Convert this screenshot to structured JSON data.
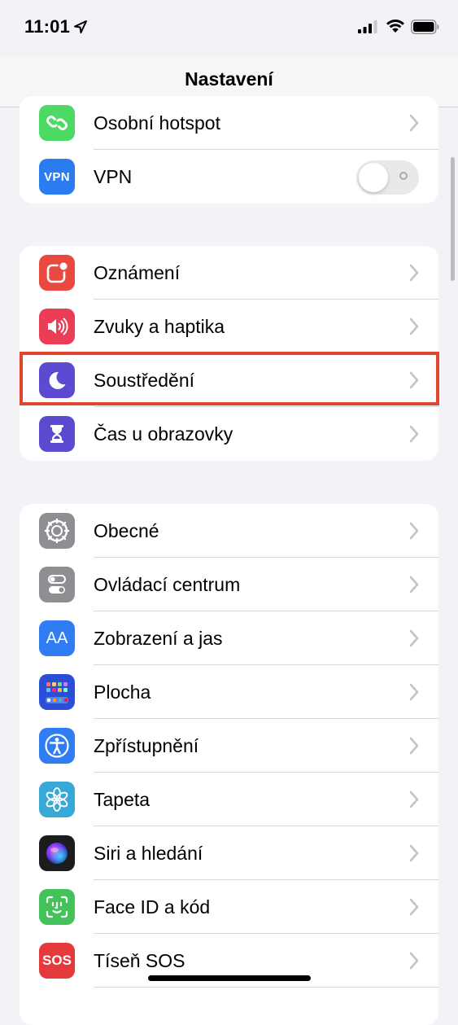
{
  "status_bar": {
    "time": "11:01"
  },
  "nav": {
    "title": "Nastavení"
  },
  "colors": {
    "highlight": "#e0452e",
    "hotspot": "#4cd964",
    "vpn": "#2b7cf0",
    "notifications": "#e9493f",
    "sounds": "#eb3d55",
    "focus": "#5a4bd1",
    "screen_time": "#5a4bd1",
    "general": "#8e8e93",
    "control_center": "#8e8e93",
    "display": "#2f7cf3",
    "home_screen": "#2a4fd6",
    "accessibility": "#2f7cf3",
    "wallpaper": "#38a8d6",
    "siri": "#1c1c1e",
    "face_id": "#44c25a",
    "sos": "#e5393b"
  },
  "groups": [
    {
      "rows": [
        {
          "label": "Osobní hotspot",
          "icon": "hotspot-chain-icon",
          "accessory": "chevron"
        },
        {
          "label": "VPN",
          "icon": "vpn-icon",
          "icon_text": "VPN",
          "accessory": "toggle",
          "toggle_on": false
        }
      ]
    },
    {
      "rows": [
        {
          "label": "Oznámení",
          "icon": "notifications-icon",
          "accessory": "chevron"
        },
        {
          "label": "Zvuky a haptika",
          "icon": "speaker-icon",
          "accessory": "chevron"
        },
        {
          "label": "Soustředění",
          "icon": "moon-icon",
          "accessory": "chevron",
          "highlighted": true
        },
        {
          "label": "Čas u obrazovky",
          "icon": "hourglass-icon",
          "accessory": "chevron"
        }
      ]
    },
    {
      "rows": [
        {
          "label": "Obecné",
          "icon": "gear-icon",
          "accessory": "chevron"
        },
        {
          "label": "Ovládací centrum",
          "icon": "switches-icon",
          "accessory": "chevron"
        },
        {
          "label": "Zobrazení a jas",
          "icon": "text-size-icon",
          "icon_text": "AA",
          "accessory": "chevron"
        },
        {
          "label": "Plocha",
          "icon": "home-screen-grid-icon",
          "accessory": "chevron"
        },
        {
          "label": "Zpřístupnění",
          "icon": "accessibility-person-icon",
          "accessory": "chevron"
        },
        {
          "label": "Tapeta",
          "icon": "flower-icon",
          "accessory": "chevron"
        },
        {
          "label": "Siri a hledání",
          "icon": "siri-orb-icon",
          "accessory": "chevron"
        },
        {
          "label": "Face ID a kód",
          "icon": "face-id-icon",
          "accessory": "chevron"
        },
        {
          "label": "Tíseň SOS",
          "icon": "sos-icon",
          "icon_text": "SOS",
          "accessory": "chevron"
        }
      ]
    }
  ]
}
